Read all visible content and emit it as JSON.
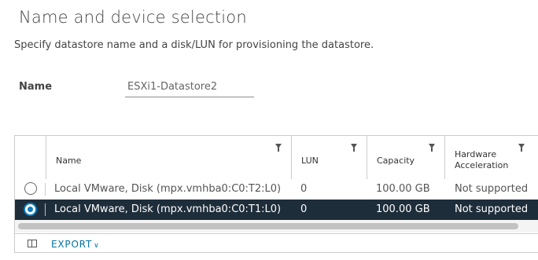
{
  "page": {
    "title": "Name and device selection",
    "description": "Specify datastore name and a disk/LUN for provisioning the datastore."
  },
  "form": {
    "name_label": "Name",
    "name_value": "ESXi1-Datastore2"
  },
  "grid": {
    "columns": [
      {
        "label": "Name",
        "filter_icon": "filter-icon"
      },
      {
        "label": "LUN",
        "filter_icon": "filter-icon"
      },
      {
        "label": "Capacity",
        "filter_icon": "filter-icon"
      },
      {
        "label": "Hardware Acceleration",
        "filter_icon": "filter-icon"
      }
    ],
    "rows": [
      {
        "selected": false,
        "name": "Local VMware, Disk (mpx.vmhba0:C0:T2:L0)",
        "lun": "0",
        "capacity": "100.00 GB",
        "hw_accel": "Not supported"
      },
      {
        "selected": true,
        "name": "Local VMware, Disk (mpx.vmhba0:C0:T1:L0)",
        "lun": "0",
        "capacity": "100.00 GB",
        "hw_accel": "Not supported"
      }
    ],
    "footer": {
      "column_toggle_icon": "columns-icon",
      "export_label": "EXPORT",
      "export_icon": "chevron-down-icon"
    }
  },
  "colors": {
    "selected_row_bg": "#1e2d3a",
    "link": "#0072a3",
    "radio_selected": "#0a7cc1"
  }
}
